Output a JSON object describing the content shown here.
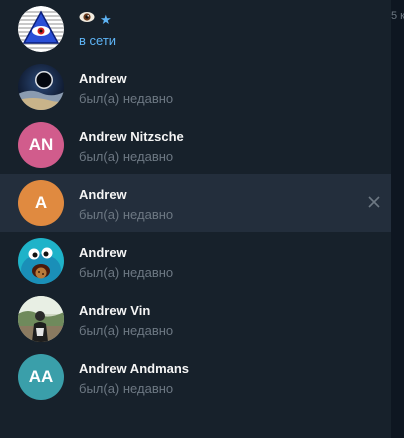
{
  "colors": {
    "background": "#17212b",
    "hover_row": "#232e3c",
    "name_text": "#f5f5f5",
    "status_text": "#6d7883",
    "online_text": "#5eb5f7",
    "avatar_pink": "#d15c8c",
    "avatar_orange": "#e08a40",
    "avatar_teal": "#3a9faa"
  },
  "edge_peek_text": "5 к",
  "contacts": [
    {
      "name": "",
      "name_icons": [
        "eye-emoji-icon",
        "star-icon"
      ],
      "status": "в сети",
      "avatar": "illuminati-eye-icon"
    },
    {
      "name": "Andrew",
      "status": "был(а) недавно",
      "avatar": "eclipse-photo"
    },
    {
      "name": "Andrew Nitzsche",
      "status": "был(а) недавно",
      "avatar_initials": "AN"
    },
    {
      "name": "Andrew",
      "status": "был(а) недавно",
      "avatar_initials": "A",
      "hovered": true
    },
    {
      "name": "Andrew",
      "status": "был(а) недавно",
      "avatar": "cookie-monster-photo"
    },
    {
      "name": "Andrew Vin",
      "status": "был(а) недавно",
      "avatar": "person-photo"
    },
    {
      "name": "Andrew Andmans",
      "status": "был(а) недавно",
      "avatar_initials": "AA"
    }
  ]
}
